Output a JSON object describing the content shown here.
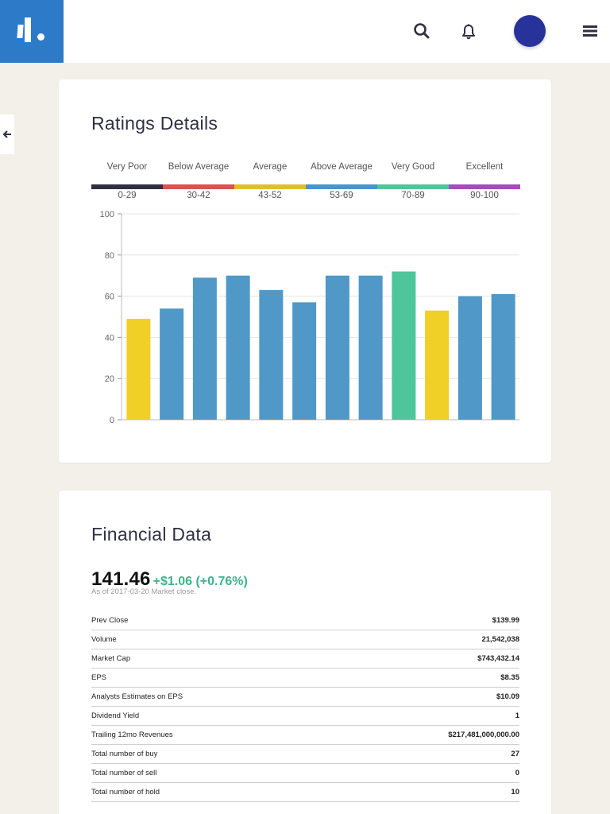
{
  "header": {
    "icons": [
      "search-icon",
      "bell-icon",
      "menu-icon"
    ],
    "avatar_color": "#27339a",
    "logo_color": "#2d7bc8"
  },
  "ratings": {
    "title": "Ratings Details",
    "legend": [
      {
        "label": "Very Poor",
        "range": "0-29",
        "color": "#2f3043"
      },
      {
        "label": "Below Average",
        "range": "30-42",
        "color": "#d9534f"
      },
      {
        "label": "Average",
        "range": "43-52",
        "color": "#e0c02a"
      },
      {
        "label": "Above Average",
        "range": "53-69",
        "color": "#4a94c9"
      },
      {
        "label": "Very Good",
        "range": "70-89",
        "color": "#4fc59c"
      },
      {
        "label": "Excellent",
        "range": "90-100",
        "color": "#a24fb8"
      }
    ]
  },
  "chart_data": {
    "type": "bar",
    "title": "",
    "xlabel": "",
    "ylabel": "",
    "ylim": [
      0,
      100
    ],
    "yticks": [
      0,
      20,
      40,
      60,
      80,
      100
    ],
    "grid": true,
    "values": [
      49,
      54,
      69,
      70,
      63,
      57,
      70,
      70,
      72,
      53,
      60,
      61
    ],
    "colors": [
      "#f0cf26",
      "#4f98c8",
      "#4f98c8",
      "#4f98c8",
      "#4f98c8",
      "#4f98c8",
      "#4f98c8",
      "#4f98c8",
      "#4fc59c",
      "#f0cf26",
      "#4f98c8",
      "#4f98c8"
    ]
  },
  "financial": {
    "title": "Financial Data",
    "price": "141.46",
    "change": "+$1.06 (+0.76%)",
    "as_of": "As of 2017-03-20 Market close.",
    "rows": [
      {
        "label": "Prev Close",
        "value": "$139.99"
      },
      {
        "label": "Volume",
        "value": "21,542,038"
      },
      {
        "label": "Market Cap",
        "value": "$743,432.14"
      },
      {
        "label": "EPS",
        "value": "$8.35"
      },
      {
        "label": "Analysts Estimates on EPS",
        "value": "$10.09"
      },
      {
        "label": "Dividend Yield",
        "value": "1"
      },
      {
        "label": "Trailing 12mo Revenues",
        "value": "$217,481,000,000.00"
      },
      {
        "label": "Total number of buy",
        "value": "27"
      },
      {
        "label": "Total number of sell",
        "value": "0"
      },
      {
        "label": "Total number of hold",
        "value": "10"
      }
    ]
  }
}
